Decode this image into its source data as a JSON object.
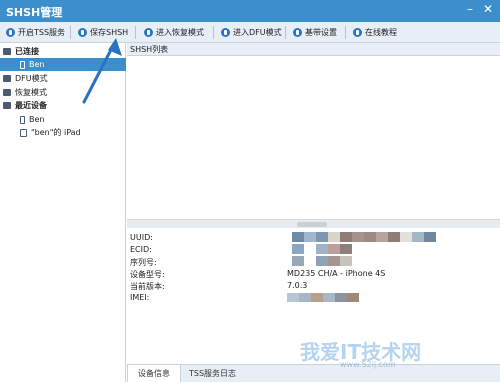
{
  "window": {
    "title": "SHSH管理"
  },
  "toolbar": {
    "items": [
      {
        "label": "开启TSS服务"
      },
      {
        "label": "保存SHSH"
      },
      {
        "label": "进入恢复模式"
      },
      {
        "label": "进入DFU模式"
      },
      {
        "label": "基带设置"
      },
      {
        "label": "在线教程"
      }
    ]
  },
  "sidebar": {
    "connected": "已连接",
    "device_ben": "Ben",
    "dfu_mode": "DFU模式",
    "recovery_mode": "恢复模式",
    "recent": "最近设备",
    "recent_ben": "Ben",
    "recent_ipad": "\"ben\"的 iPad"
  },
  "list": {
    "header": "SHSH列表"
  },
  "info": {
    "labels": [
      "UUID:",
      "ECID:",
      "序列号:",
      "设备型号:",
      "当前版本:",
      "IMEI:"
    ],
    "model": "MD235 CH/A - iPhone 4S",
    "version": "7.0.3"
  },
  "tabs": {
    "device_info": "设备信息",
    "tss_log": "TSS服务日志"
  },
  "watermark": {
    "text": "我爱IT技术网",
    "url": "www.52ij.com"
  },
  "colors": {
    "accent": "#3c8fcd",
    "arrow": "#2a73c2"
  }
}
